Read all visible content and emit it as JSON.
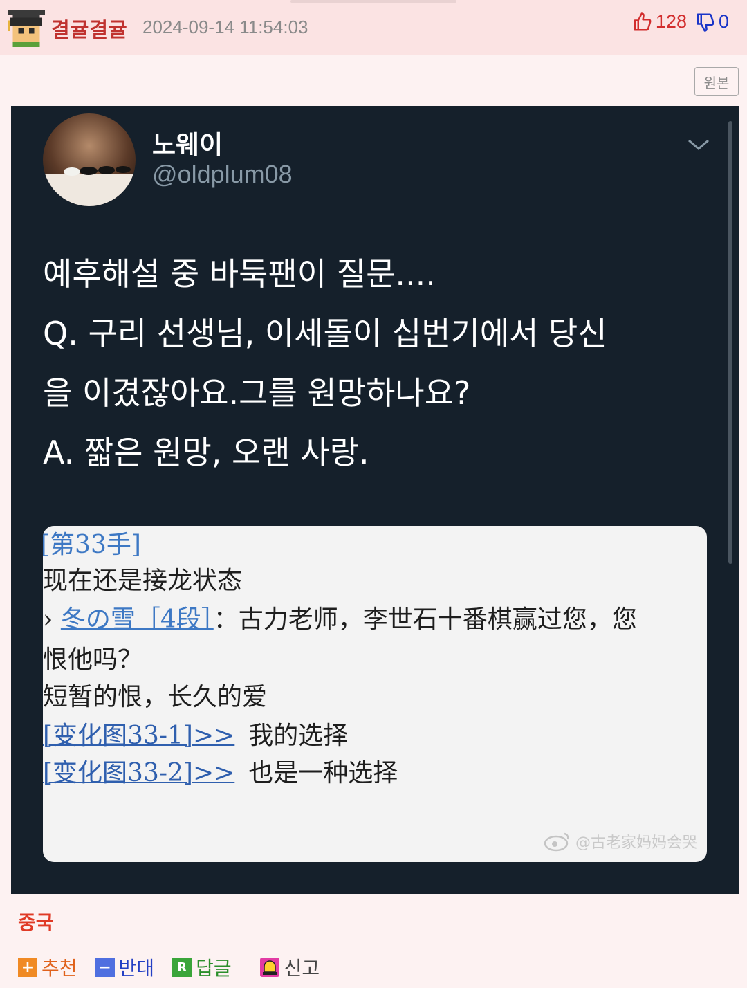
{
  "post": {
    "author": "결귤결귤",
    "timestamp": "2024-09-14 11:54:03",
    "upvotes": "128",
    "downvotes": "0",
    "original_button": "원본",
    "category": "중국"
  },
  "tweet": {
    "display_name": "노웨이",
    "handle": "@oldplum08",
    "lines": [
      "예후해설 중 바둑팬이 질문....",
      "Q. 구리 선생님, 이세돌이 십번기에서 당신",
      "을 이겼잖아요.그를 원망하나요?",
      "A. 짧은 원망, 오랜 사랑."
    ]
  },
  "screenshot": {
    "turn": "[第33手]",
    "line1": "现在还是接龙状态",
    "asker_prefix": "› ",
    "asker": "冬の雪［4段］",
    "question_a": "：古力老师，李世石十番棋赢过您，您",
    "question_b": "恨他吗？",
    "answer": "短暂的恨，长久的爱",
    "variation1_link": "[变化图33-1]>>",
    "variation1_text": "我的选择",
    "variation2_link": "[变化图33-2]>>",
    "variation2_text": "也是一种选择",
    "watermark": "@古老家妈妈会哭"
  },
  "actions": {
    "recommend": "추천",
    "oppose": "반대",
    "reply": "답글",
    "report": "신고",
    "recommend_icon": "plus-icon",
    "oppose_icon": "minus-icon",
    "reply_icon": "reply-r-icon",
    "report_icon": "siren-icon"
  },
  "colors": {
    "header_bg": "#fbe3e3",
    "page_bg": "#fdf2f2",
    "tweet_bg": "#15202b",
    "author": "#c0322f",
    "upvote": "#d22d2d",
    "downvote": "#1a35c8"
  }
}
